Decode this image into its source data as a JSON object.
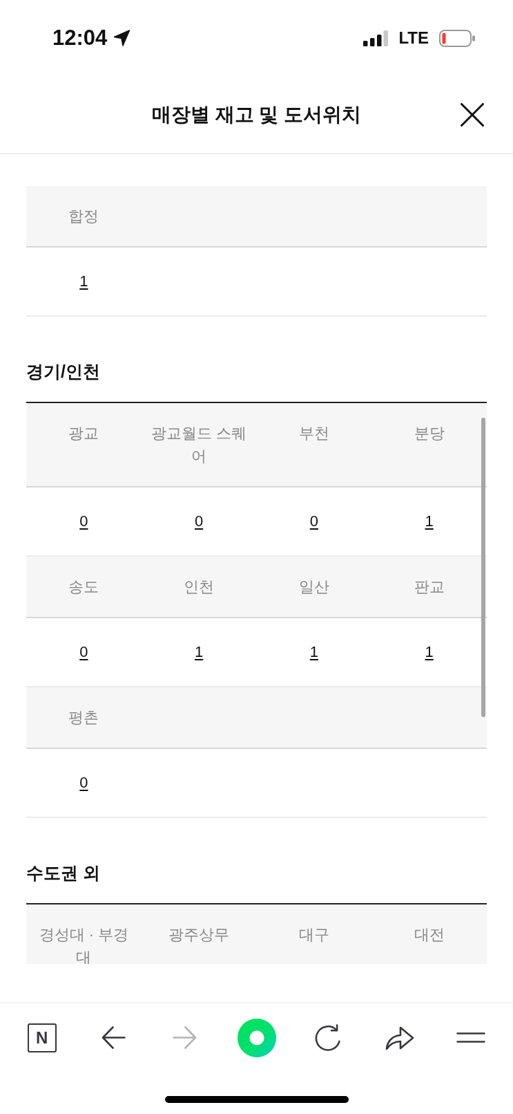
{
  "status_bar": {
    "time": "12:04",
    "network": "LTE"
  },
  "header": {
    "title": "매장별 재고 및 도서위치"
  },
  "sections": [
    {
      "stores": [
        {
          "name": "합정",
          "stock": "1"
        }
      ]
    },
    {
      "title": "경기/인천",
      "stores": [
        {
          "name": "광교",
          "stock": "0"
        },
        {
          "name": "광교월드 스퀘어",
          "stock": "0"
        },
        {
          "name": "부천",
          "stock": "0"
        },
        {
          "name": "분당",
          "stock": "1"
        },
        {
          "name": "송도",
          "stock": "0"
        },
        {
          "name": "인천",
          "stock": "1"
        },
        {
          "name": "일산",
          "stock": "1"
        },
        {
          "name": "판교",
          "stock": "1"
        },
        {
          "name": "평촌",
          "stock": "0"
        }
      ]
    },
    {
      "title": "수도권 외",
      "stores": [
        {
          "name": "경성대 · 부경대"
        },
        {
          "name": "광주상무"
        },
        {
          "name": "대구"
        },
        {
          "name": "대전"
        }
      ]
    }
  ],
  "toolbar": [
    {
      "kind": "logo",
      "label": "N",
      "disabled": false
    },
    {
      "kind": "back",
      "disabled": false
    },
    {
      "kind": "forward",
      "disabled": true
    },
    {
      "kind": "assistant",
      "disabled": false
    },
    {
      "kind": "reload",
      "disabled": false
    },
    {
      "kind": "share",
      "disabled": false
    },
    {
      "kind": "menu",
      "disabled": false
    }
  ]
}
